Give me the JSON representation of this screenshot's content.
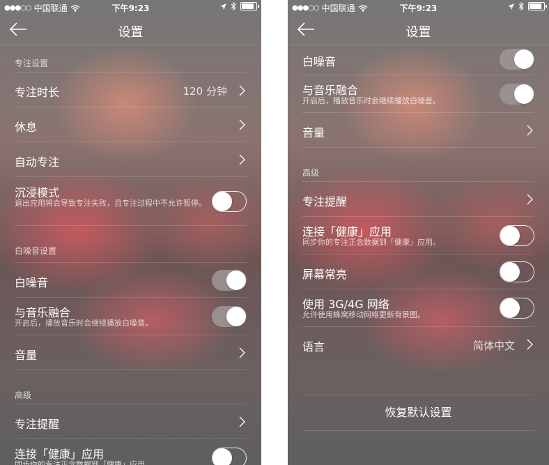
{
  "status": {
    "carrier": "中国联通",
    "time": "下午9:23"
  },
  "nav": {
    "title": "设置"
  },
  "labels": {
    "focus_section": "专注设置",
    "focus_duration": "专注时长",
    "focus_duration_value": "120 分钟",
    "rest": "休息",
    "auto_focus": "自动专注",
    "immersive": "沉浸模式",
    "immersive_sub": "退出应用将会导致专注失败，且专注过程中不允许暂停。",
    "white_noise_section": "白噪音设置",
    "white_noise": "白噪音",
    "music_mix": "与音乐融合",
    "music_mix_sub": "开启后，播放音乐时会继续播放白噪音。",
    "volume": "音量",
    "advanced_section": "高级",
    "focus_reminder": "专注提醒",
    "health": "连接「健康」应用",
    "health_sub": "同步你的专注正念数据到「健康」应用。",
    "screen_on": "屏幕常亮",
    "cellular": "使用 3G/4G 网络",
    "cellular_sub": "允许使用蜂窝移动网络更新背景图。",
    "language": "语言",
    "language_value": "简体中文",
    "reset": "恢复默认设置"
  },
  "toggles": {
    "immersive": false,
    "white_noise": true,
    "music_mix": true,
    "health": false,
    "screen_on": false,
    "cellular": false
  },
  "colors": {
    "text": "#ffffff",
    "toggle_on": "#a09696",
    "knob": "#ffffff"
  }
}
